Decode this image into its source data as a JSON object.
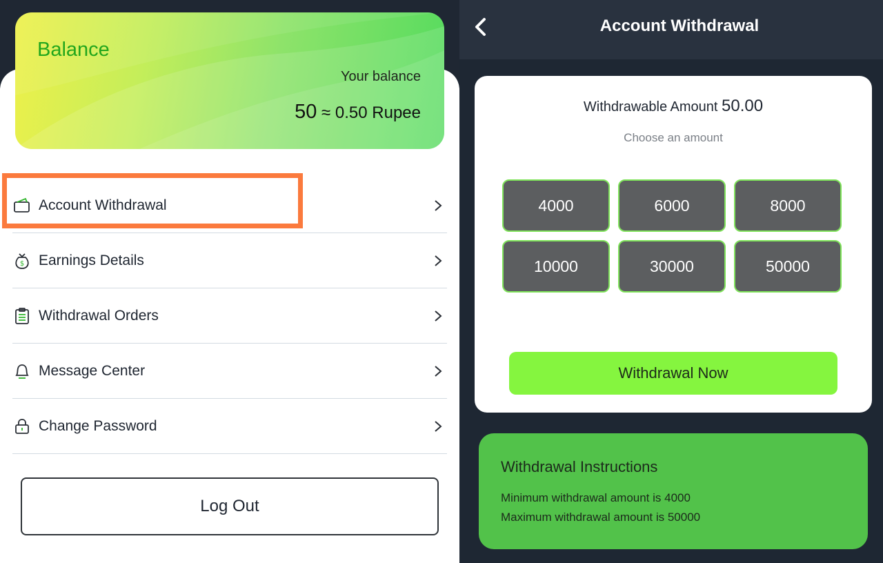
{
  "left": {
    "balance": {
      "title": "Balance",
      "subtitle": "Your balance",
      "points": "50",
      "conversion": "≈ 0.50 Rupee"
    },
    "menu": [
      {
        "label": "Account Withdrawal",
        "icon": "wallet-icon"
      },
      {
        "label": "Earnings Details",
        "icon": "money-bag-icon"
      },
      {
        "label": "Withdrawal Orders",
        "icon": "clipboard-icon"
      },
      {
        "label": "Message Center",
        "icon": "bell-icon"
      },
      {
        "label": "Change Password",
        "icon": "lock-icon"
      }
    ],
    "logout_label": "Log Out"
  },
  "right": {
    "header_title": "Account Withdrawal",
    "withdrawable_label": "Withdrawable Amount",
    "withdrawable_value": "50.00",
    "choose_label": "Choose an amount",
    "amounts": [
      "4000",
      "6000",
      "8000",
      "10000",
      "30000",
      "50000"
    ],
    "withdraw_button": "Withdrawal Now",
    "instructions": {
      "title": "Withdrawal Instructions",
      "min_line": "Minimum withdrawal amount is 4000",
      "max_line": "Maximum withdrawal amount is 50000"
    }
  },
  "colors": {
    "highlight": "#fb7a3d",
    "accent_green": "#85f53f",
    "balance_title": "#22a61d",
    "instructions_bg": "#52c24a",
    "amount_button": "#5c5e60"
  }
}
